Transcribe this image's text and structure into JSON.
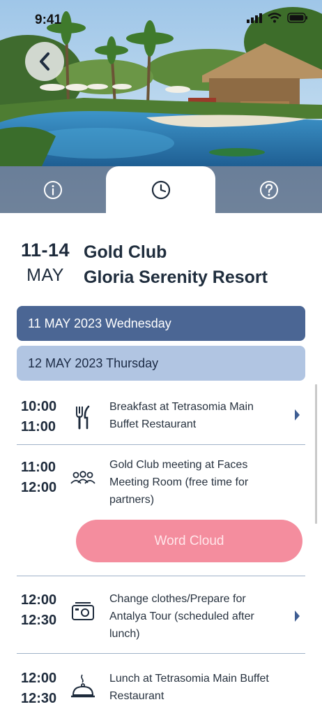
{
  "status": {
    "time": "9:41"
  },
  "nav": {
    "back_icon": "chevron-left-icon",
    "tabs": [
      {
        "name": "info",
        "icon": "info-icon"
      },
      {
        "name": "schedule",
        "icon": "clock-icon",
        "selected": true
      },
      {
        "name": "help",
        "icon": "question-icon"
      }
    ]
  },
  "event": {
    "days": "11-14",
    "month": "MAY",
    "title_line1": "Gold Club",
    "title_line2": "Gloria Serenity Resort"
  },
  "days": [
    {
      "label": "11 MAY 2023 Wednesday",
      "state": "collapsed"
    },
    {
      "label": "12 MAY 2023 Thursday",
      "state": "expanded"
    }
  ],
  "schedule": [
    {
      "start": "10:00",
      "end": "11:00",
      "icon": "cutlery-icon",
      "line1": "Breakfast at Tetrasomia Main",
      "line2": "Buffet Restaurant",
      "line3": ""
    },
    {
      "start": "11:00",
      "end": "12:00",
      "icon": "group-icon",
      "line1": "Gold Club meeting at Faces",
      "line2": "Meeting Room (free time for",
      "line3": "partners)"
    },
    {
      "start": "12:00",
      "end": "12:30",
      "icon": "camera-icon",
      "line1": "Change clothes/Prepare for",
      "line2": "Antalya Tour (scheduled after",
      "line3": "lunch)"
    },
    {
      "start": "12:00",
      "end": "12:30",
      "icon": "cloche-icon",
      "line1": "Lunch at Tetrasomia Main Buffet",
      "line2": "Restaurant",
      "line3": ""
    }
  ],
  "word_cloud_label": "Word Cloud",
  "colors": {
    "accent_dark": "#4b6694",
    "accent_light": "#b1c5e2",
    "pink_button": "#f48d9e",
    "text_primary": "#1d2a3b"
  }
}
